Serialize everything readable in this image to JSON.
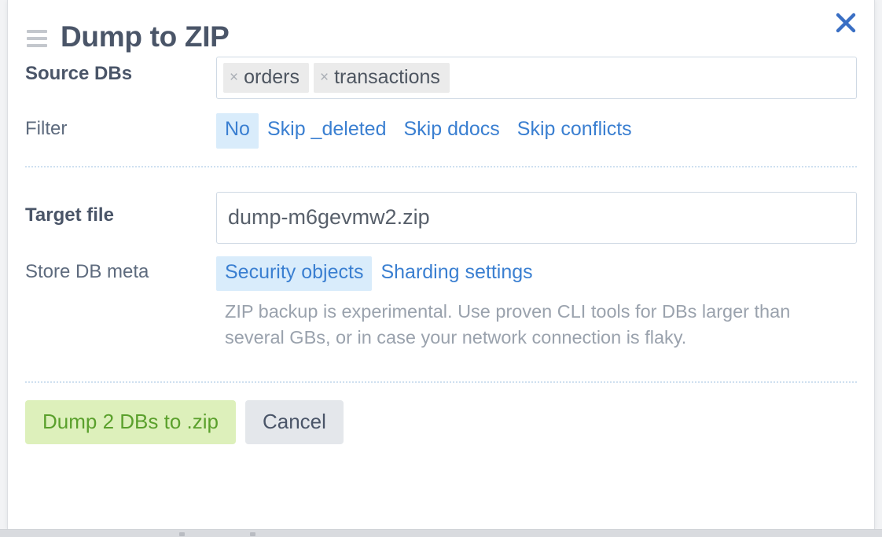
{
  "dialog": {
    "title": "Dump to ZIP",
    "menu_icon": "hamburger-icon",
    "close_icon": "close-icon"
  },
  "source_dbs": {
    "label": "Source DBs",
    "tags": [
      {
        "name": "orders",
        "remove_icon": "×"
      },
      {
        "name": "transactions",
        "remove_icon": "×"
      }
    ]
  },
  "filter": {
    "label": "Filter",
    "options": [
      {
        "label": "No",
        "selected": true
      },
      {
        "label": "Skip _deleted",
        "selected": false
      },
      {
        "label": "Skip ddocs",
        "selected": false
      },
      {
        "label": "Skip conflicts",
        "selected": false
      }
    ]
  },
  "target_file": {
    "label": "Target file",
    "value": "dump-m6gevmw2.zip"
  },
  "store_db_meta": {
    "label": "Store DB meta",
    "options": [
      {
        "label": "Security objects",
        "selected": true
      },
      {
        "label": "Sharding settings",
        "selected": false
      }
    ],
    "hint": "ZIP backup is experimental. Use proven CLI tools for DBs larger than several GBs, or in case your network connection is flaky."
  },
  "footer": {
    "submit_label": "Dump 2 DBs to .zip",
    "cancel_label": "Cancel"
  },
  "colors": {
    "accent_link": "#3a7fd1",
    "selected_bg": "#d9ecfb",
    "primary_btn_bg": "#ddf0bb",
    "primary_btn_text": "#5aa02c",
    "secondary_btn_bg": "#e4e7eb",
    "title_text": "#4a5568",
    "hint_text": "#9aa2ad"
  }
}
